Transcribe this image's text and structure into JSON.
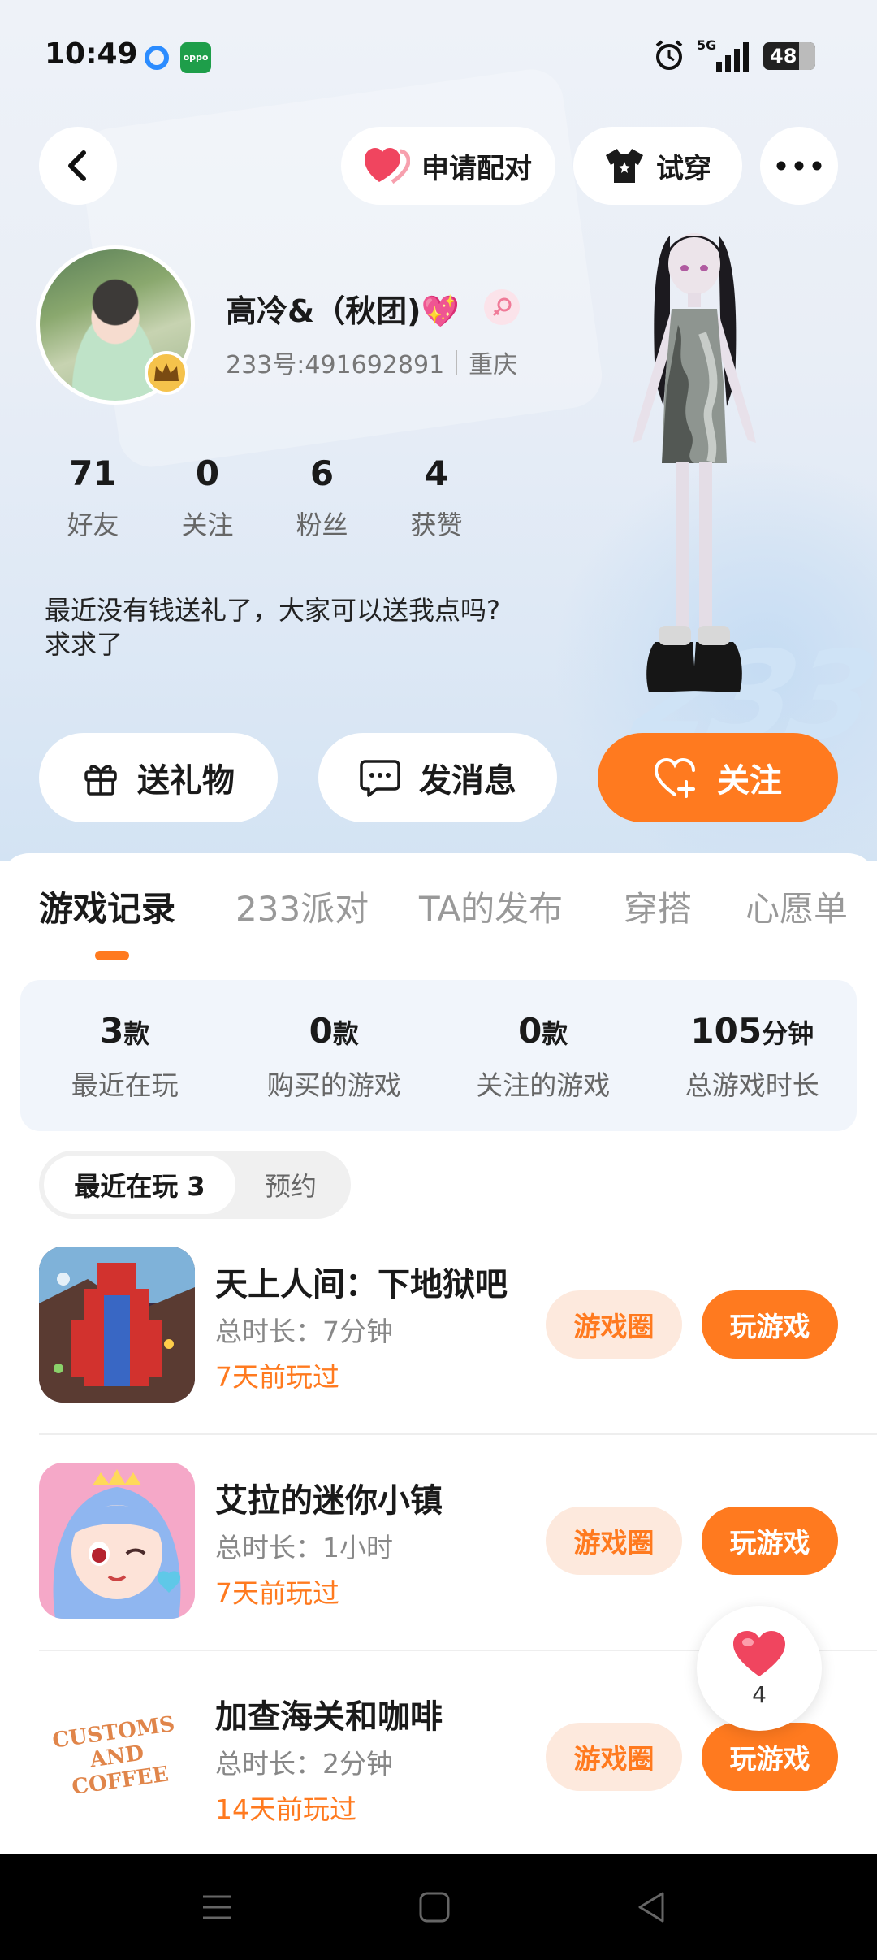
{
  "status_bar": {
    "time": "10:49",
    "network": "5G",
    "battery": "48"
  },
  "top_bar": {
    "pair_label": "申请配对",
    "tryon_label": "试穿"
  },
  "profile": {
    "username": "高冷&（秋团)💖",
    "uid": "233号:491692891",
    "location": "重庆",
    "stats": [
      {
        "value": "71",
        "label": "好友"
      },
      {
        "value": "0",
        "label": "关注"
      },
      {
        "value": "6",
        "label": "粉丝"
      },
      {
        "value": "4",
        "label": "获赞"
      }
    ],
    "bio_line1": "最近没有钱送礼了，大家可以送我点吗?",
    "bio_line2": "求求了"
  },
  "actions": {
    "gift": "送礼物",
    "message": "发消息",
    "follow": "关注"
  },
  "tabs": [
    "游戏记录",
    "233派对",
    "TA的发布",
    "穿搭",
    "心愿单"
  ],
  "summary": [
    {
      "num": "3",
      "unit": "款",
      "label": "最近在玩"
    },
    {
      "num": "0",
      "unit": "款",
      "label": "购买的游戏"
    },
    {
      "num": "0",
      "unit": "款",
      "label": "关注的游戏"
    },
    {
      "num": "105",
      "unit": "分钟",
      "label": "总游戏时长"
    }
  ],
  "subtabs": {
    "recent": "最近在玩 3",
    "reserve": "预约"
  },
  "games": [
    {
      "name": "天上人间：下地狱吧",
      "time": "总时长：7分钟",
      "last": "7天前玩过",
      "circle": "游戏圈",
      "play": "玩游戏"
    },
    {
      "name": "艾拉的迷你小镇",
      "time": "总时长：1小时",
      "last": "7天前玩过",
      "circle": "游戏圈",
      "play": "玩游戏"
    },
    {
      "name": "加查海关和咖啡",
      "time": "总时长：2分钟",
      "last": "14天前玩过",
      "circle": "游戏圈",
      "play": "玩游戏",
      "icon_text": "CUSTOMS AND COFFEE"
    }
  ],
  "float_like": {
    "count": "4"
  },
  "colors": {
    "accent": "#ff7a1f",
    "accent_light": "#fde9dd",
    "heart": "#f0455f"
  }
}
